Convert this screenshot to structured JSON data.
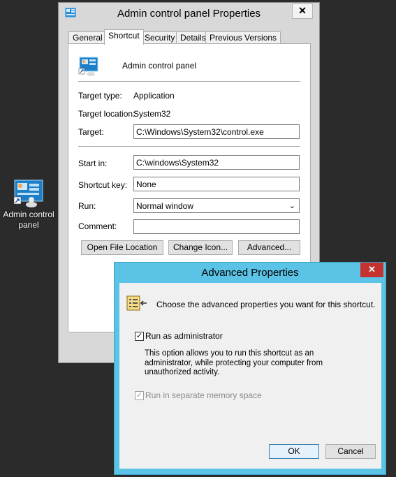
{
  "desktop": {
    "icon_label": "Admin control panel"
  },
  "properties": {
    "title": "Admin control panel Properties",
    "close_glyph": "✕",
    "tabs": [
      "General",
      "Shortcut",
      "Security",
      "Details",
      "Previous Versions"
    ],
    "shortcut_name": "Admin control panel",
    "target_type_label": "Target type:",
    "target_type_value": "Application",
    "target_location_label": "Target location:",
    "target_location_value": "System32",
    "target_label": "Target:",
    "target_value": "C:\\Windows\\System32\\control.exe",
    "start_in_label": "Start in:",
    "start_in_value": "C:\\windows\\System32",
    "shortcut_key_label": "Shortcut key:",
    "shortcut_key_value": "None",
    "run_label": "Run:",
    "run_value": "Normal window",
    "comment_label": "Comment:",
    "comment_value": "",
    "buttons": {
      "open_file_location": "Open File Location",
      "change_icon": "Change Icon...",
      "advanced": "Advanced..."
    }
  },
  "advanced": {
    "title": "Advanced Properties",
    "close_glyph": "✕",
    "prompt": "Choose the advanced properties you want for this shortcut.",
    "run_as_admin_label": "Run as administrator",
    "run_as_admin_checked": true,
    "description": "This option allows you to run this shortcut as an administrator, while protecting your computer from unauthorized activity.",
    "separate_memory_label": "Run in separate memory space",
    "separate_memory_checked": true,
    "ok_label": "OK",
    "cancel_label": "Cancel"
  }
}
